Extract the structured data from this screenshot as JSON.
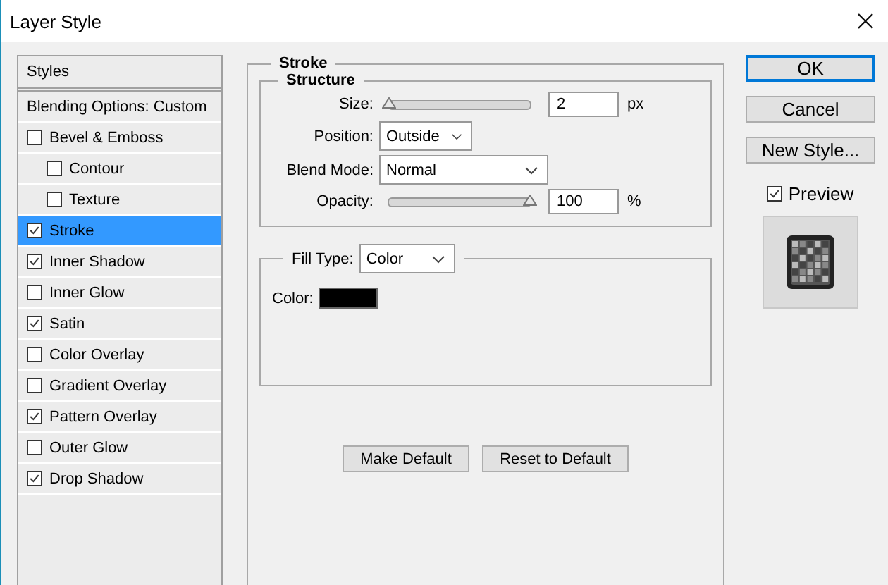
{
  "window": {
    "title": "Layer Style"
  },
  "styles_list": {
    "header": "Styles",
    "items": [
      {
        "kind": "heading",
        "label": "Blending Options: Custom",
        "selected": false
      },
      {
        "kind": "checkbox",
        "label": "Bevel & Emboss",
        "checked": false,
        "selected": false,
        "children": [
          {
            "kind": "checkbox",
            "label": "Contour",
            "checked": false,
            "selected": false
          },
          {
            "kind": "checkbox",
            "label": "Texture",
            "checked": false,
            "selected": false
          }
        ]
      },
      {
        "kind": "checkbox",
        "label": "Stroke",
        "checked": true,
        "selected": true
      },
      {
        "kind": "checkbox",
        "label": "Inner Shadow",
        "checked": true,
        "selected": false
      },
      {
        "kind": "checkbox",
        "label": "Inner Glow",
        "checked": false,
        "selected": false
      },
      {
        "kind": "checkbox",
        "label": "Satin",
        "checked": true,
        "selected": false
      },
      {
        "kind": "checkbox",
        "label": "Color Overlay",
        "checked": false,
        "selected": false
      },
      {
        "kind": "checkbox",
        "label": "Gradient Overlay",
        "checked": false,
        "selected": false
      },
      {
        "kind": "checkbox",
        "label": "Pattern Overlay",
        "checked": true,
        "selected": false
      },
      {
        "kind": "checkbox",
        "label": "Outer Glow",
        "checked": false,
        "selected": false
      },
      {
        "kind": "checkbox",
        "label": "Drop Shadow",
        "checked": true,
        "selected": false
      }
    ]
  },
  "stroke_panel": {
    "title": "Stroke",
    "structure": {
      "title": "Structure",
      "size": {
        "label": "Size:",
        "level": 0,
        "value": "2",
        "unit": "px"
      },
      "position": {
        "label": "Position:",
        "value": "Outside"
      },
      "blend_mode": {
        "label": "Blend Mode:",
        "value": "Normal"
      },
      "opacity": {
        "label": "Opacity:",
        "level": 1,
        "value": "100",
        "unit": "%"
      }
    },
    "fill": {
      "label": "Fill Type:",
      "value": "Color",
      "color_label": "Color:",
      "color": "#000000"
    },
    "buttons": [
      "Make Default",
      "Reset to Default"
    ]
  },
  "buttons": [
    {
      "label": "OK",
      "default": true
    },
    {
      "label": "Cancel",
      "default": false
    },
    {
      "label": "New Style...",
      "default": false
    }
  ],
  "preview": {
    "label": "Preview",
    "checked": true
  }
}
